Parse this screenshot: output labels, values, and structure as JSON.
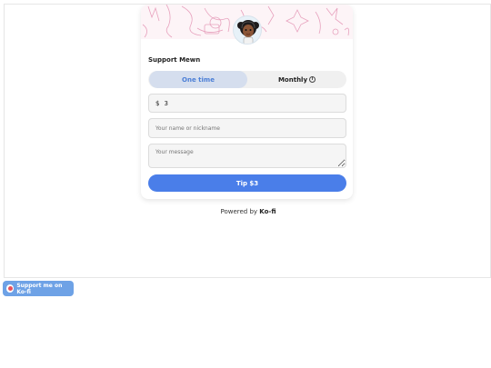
{
  "card": {
    "support_title": "Support Mewn",
    "toggle": {
      "one_time": "One time",
      "monthly": "Monthly",
      "selected": "One time"
    },
    "amount": {
      "currency": "$",
      "value": "3"
    },
    "name_placeholder": "Your name or nickname",
    "message_placeholder": "Your message",
    "tip_button": "Tip $3"
  },
  "footer": {
    "powered_prefix": "Powered by",
    "powered_brand": "Ko-fi"
  },
  "floating_button": {
    "label": "Support me on Ko-fi"
  },
  "colors": {
    "accent": "#4a7ee9",
    "toggle_active_bg": "#d5deee",
    "float_button": "#6ea2e6",
    "banner_sketch": "#e7a1bd"
  },
  "icons": [
    "avatar",
    "info-icon",
    "ko-fi-cup-icon",
    "resize-grip-icon"
  ]
}
